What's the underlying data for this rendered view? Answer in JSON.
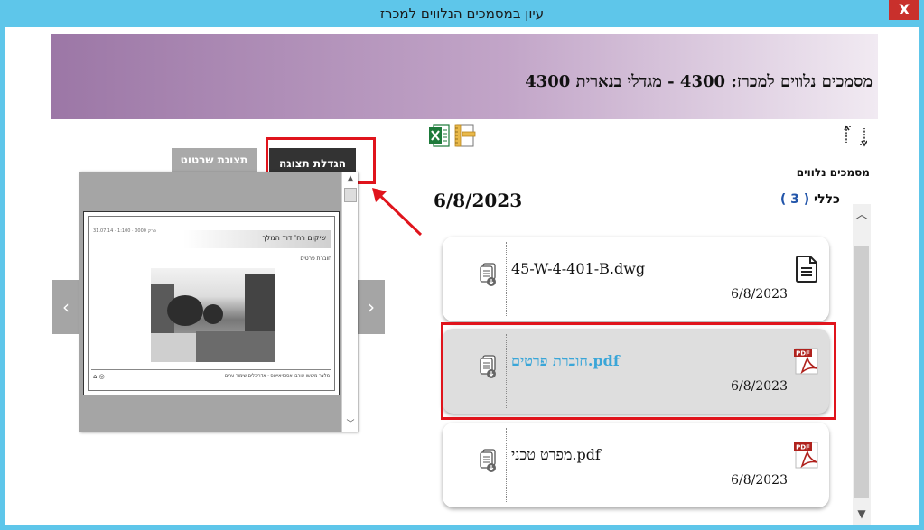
{
  "window": {
    "title": "עיון במסמכים הנלווים למכרז",
    "close_label": "X"
  },
  "header": {
    "title": "מסמכים נלווים למכרז: 4300 - מגדלי בנארית 4300"
  },
  "toolbar": {
    "sync_icon": "sync-icon",
    "excel_icon": "excel-icon",
    "drawing_icon": "ruler-drawing-icon"
  },
  "section": {
    "label": "מסמכים נלווים"
  },
  "group": {
    "name": "כללי",
    "count": "( 3 )",
    "date": "6/8/2023"
  },
  "files": [
    {
      "name": "45-W-4-401-B.dwg",
      "date": "6/8/2023",
      "type_icon": "document-icon",
      "selected": false
    },
    {
      "name": "חוברת פרטים.pdf",
      "date": "6/8/2023",
      "type_icon": "pdf-icon",
      "selected": true
    },
    {
      "name": "מפרט טכני.pdf",
      "date": "6/8/2023",
      "type_icon": "pdf-icon",
      "selected": false
    }
  ],
  "preview": {
    "enlarge_label": "הגדלת תצוגה",
    "drawing_label": "תצוגת שרטוט",
    "doc_title": "שיקום רח' דוד המלך",
    "doc_subtitle": "חוברת פרטים",
    "doc_code": "פרק 0000 · 1:100 · 31.07.14",
    "doc_footer": "מלצר מיטשן אורבן אסוסיאייטס · אדריכלים שימור ערים",
    "nav_prev": "‹",
    "nav_next": "›"
  },
  "colors": {
    "accent_red": "#e0141c",
    "header_start": "#9c77a6",
    "titlebar": "#5ec6ea",
    "link_blue": "#3aa6d8"
  }
}
